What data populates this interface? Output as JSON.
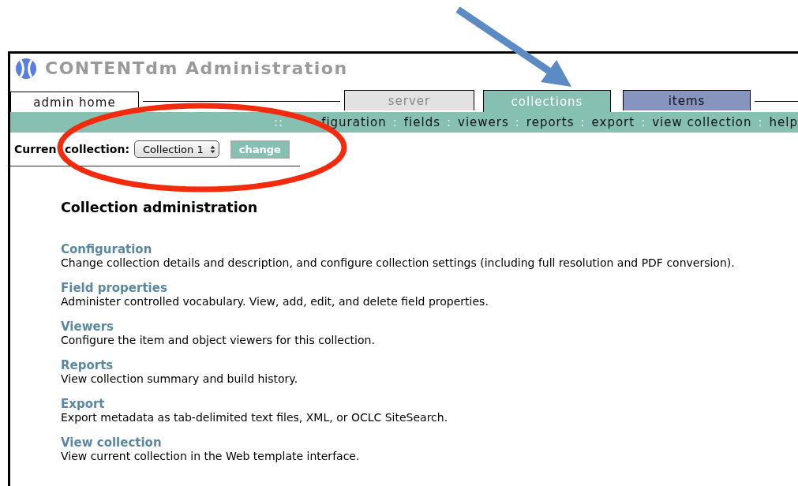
{
  "window": {
    "title": "CONTENTdm Administration"
  },
  "tabs": [
    {
      "label": "admin home",
      "selected": false,
      "disabled": false,
      "color": "#ffffff"
    },
    {
      "label": "server",
      "selected": false,
      "disabled": true,
      "color": "#e2e2e2"
    },
    {
      "label": "collections",
      "selected": true,
      "disabled": false,
      "color": "#86c0b3"
    },
    {
      "label": "items",
      "selected": false,
      "disabled": false,
      "color": "#8595c0"
    }
  ],
  "nav": {
    "prefix": "::",
    "separator": ":",
    "links": [
      "figuration",
      "fields",
      "viewers",
      "reports",
      "export",
      "view collection",
      "help"
    ]
  },
  "collection_bar": {
    "label_start": "Curren",
    "label_end": "collection:",
    "select_value": "Collection 1",
    "button": "change"
  },
  "heading": "Collection administration",
  "sections": [
    {
      "title": "Configuration",
      "description": "Change collection details and description, and configure collection settings (including full resolution and PDF conversion)."
    },
    {
      "title": "Field properties",
      "description": "Administer controlled vocabulary. View, add, edit, and delete field properties."
    },
    {
      "title": "Viewers",
      "description": "Configure the item and object viewers for this collection."
    },
    {
      "title": "Reports",
      "description": "View collection summary and build history."
    },
    {
      "title": "Export",
      "description": "Export metadata as tab-delimited text files, XML, or OCLC SiteSearch."
    },
    {
      "title": "View collection",
      "description": "View current collection in the Web template interface."
    }
  ]
}
